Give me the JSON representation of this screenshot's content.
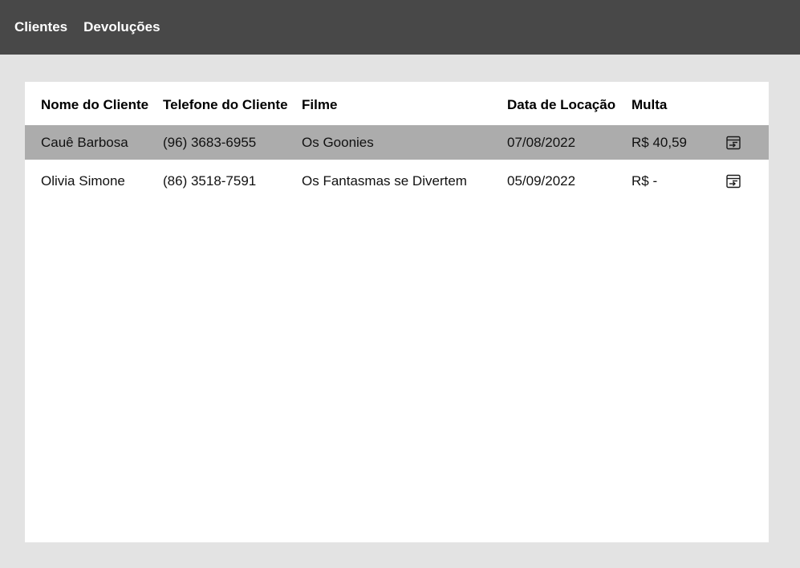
{
  "nav": {
    "clientes_label": "Clientes",
    "devolucoes_label": "Devoluções"
  },
  "table": {
    "headers": {
      "nome": "Nome do Cliente",
      "telefone": "Telefone do Cliente",
      "filme": "Filme",
      "data": "Data de Locação",
      "multa": "Multa"
    },
    "rows": [
      {
        "nome": "Cauê Barbosa",
        "telefone": "(96) 3683-6955",
        "filme": "Os Goonies",
        "data": "07/08/2022",
        "multa": "R$ 40,59",
        "action_icon": "return-icon",
        "highlighted": true
      },
      {
        "nome": "Olivia Simone",
        "telefone": "(86) 3518-7591",
        "filme": "Os Fantasmas se Divertem",
        "data": "05/09/2022",
        "multa": "R$ -",
        "action_icon": "return-icon",
        "highlighted": false
      }
    ]
  },
  "colors": {
    "topbar": "#484848",
    "background": "#e3e3e3",
    "panel": "#ffffff",
    "row_highlight": "#acacac"
  }
}
